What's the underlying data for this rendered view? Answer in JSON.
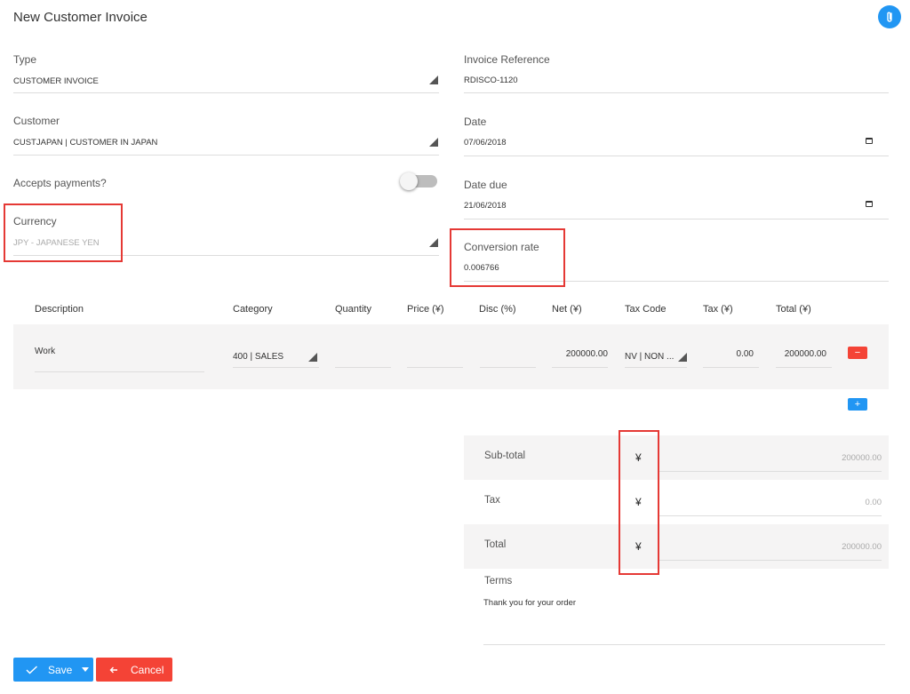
{
  "header": {
    "title": "New Customer Invoice",
    "attach_icon": "paperclip-icon"
  },
  "form": {
    "type": {
      "label": "Type",
      "value": "CUSTOMER INVOICE"
    },
    "invoice_reference": {
      "label": "Invoice Reference",
      "value": "RDISCO-1120"
    },
    "customer": {
      "label": "Customer",
      "value": "CUSTJAPAN | CUSTOMER IN JAPAN"
    },
    "date": {
      "label": "Date",
      "value": "07/06/2018"
    },
    "accepts_payments": {
      "label": "Accepts payments?",
      "enabled": false
    },
    "date_due": {
      "label": "Date due",
      "value": "21/06/2018"
    },
    "currency": {
      "label": "Currency",
      "value": "JPY - JAPANESE YEN"
    },
    "conversion_rate": {
      "label": "Conversion rate",
      "value": "0.006766"
    }
  },
  "lines": {
    "headers": [
      "Description",
      "Category",
      "Quantity",
      "Price (¥)",
      "Disc (%)",
      "Net (¥)",
      "Tax Code",
      "Tax (¥)",
      "Total (¥)"
    ],
    "rows": [
      {
        "description": "Work",
        "category": "400 | SALES",
        "quantity": "",
        "price": "",
        "disc": "",
        "net": "200000.00",
        "tax_code": "NV | NON ...",
        "tax": "0.00",
        "total": "200000.00"
      }
    ],
    "remove_symbol": "−",
    "add_symbol": "+"
  },
  "summary": {
    "currency_symbol": "¥",
    "subtotal": {
      "label": "Sub-total",
      "value": "200000.00"
    },
    "tax": {
      "label": "Tax",
      "value": "0.00"
    },
    "total": {
      "label": "Total",
      "value": "200000.00"
    },
    "terms": {
      "label": "Terms",
      "value": "Thank you for your order"
    }
  },
  "actions": {
    "save_label": "Save",
    "cancel_label": "Cancel"
  },
  "colors": {
    "primary": "#2196f3",
    "danger": "#f44336",
    "highlight": "#e53935"
  }
}
